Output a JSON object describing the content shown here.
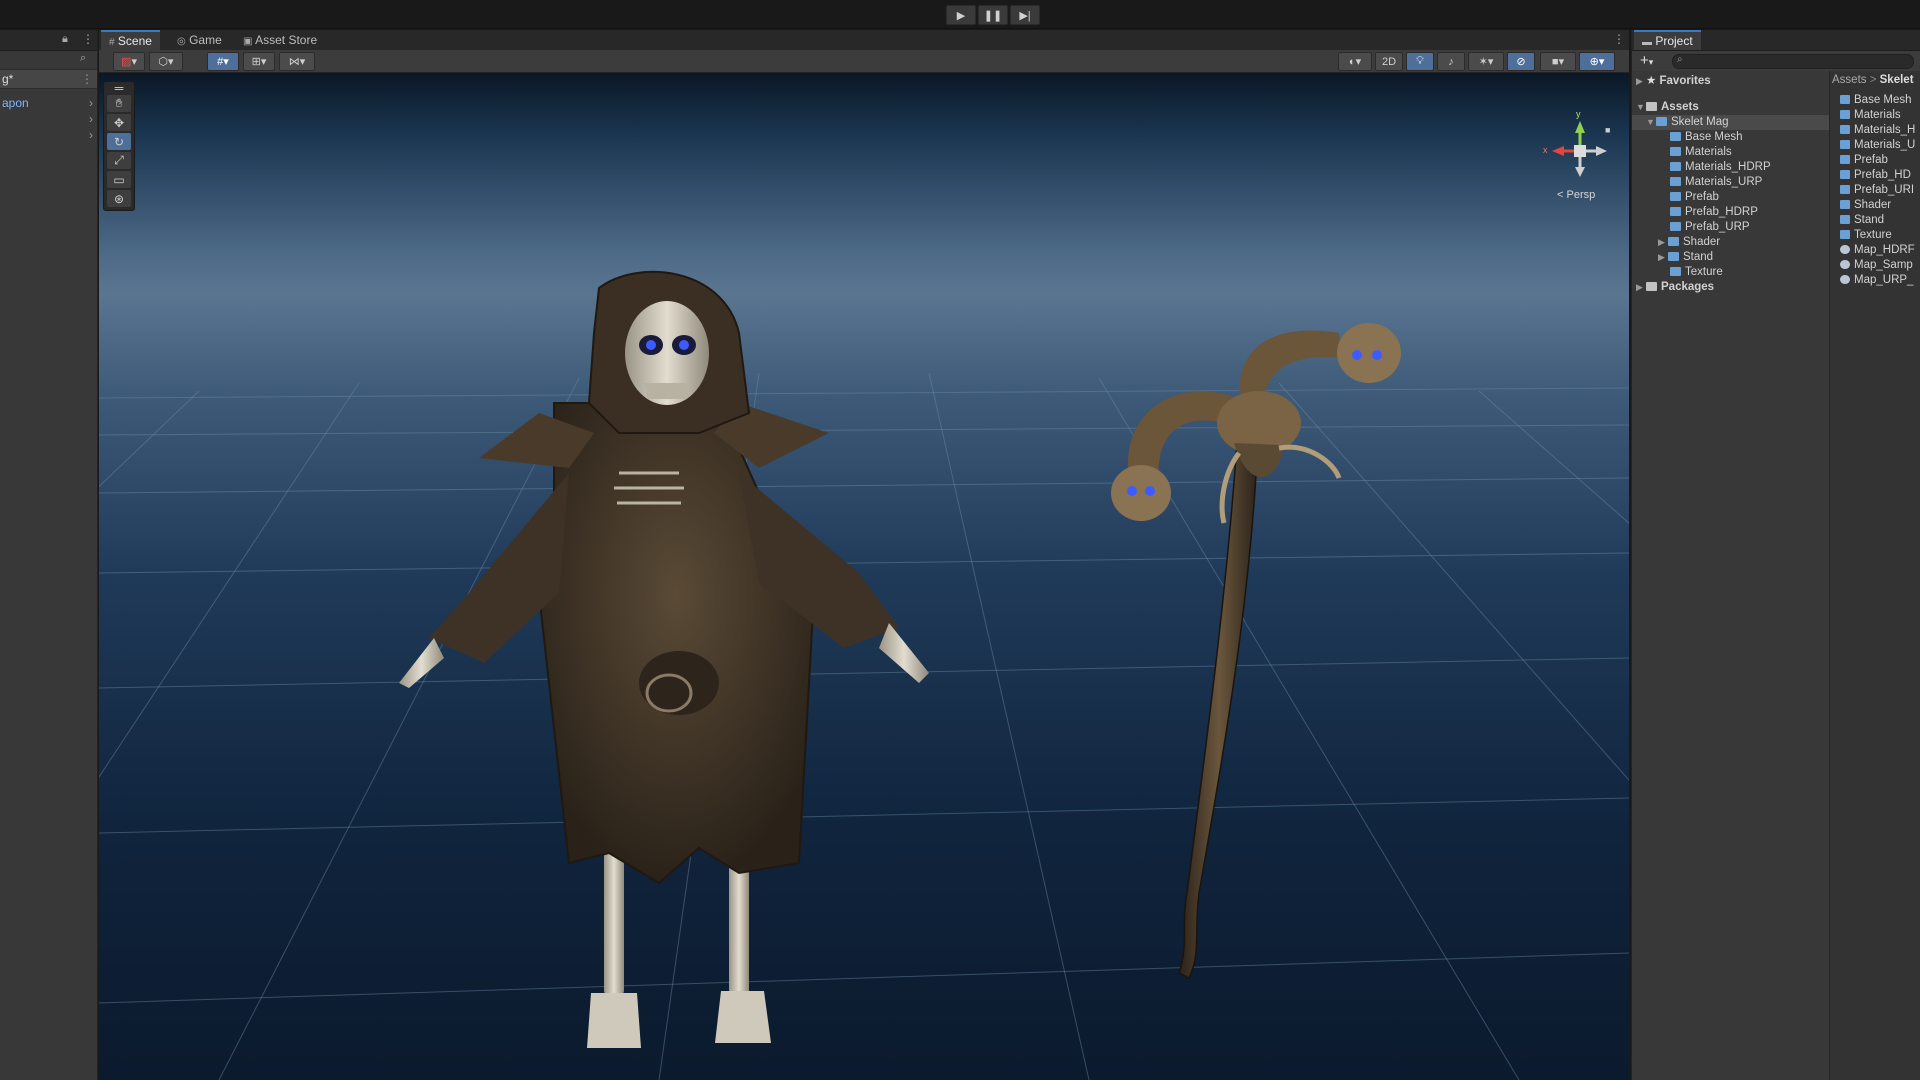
{
  "toolbar": {
    "play_icon": "play-icon",
    "pause_icon": "pause-icon",
    "step_icon": "step-icon"
  },
  "hierarchy": {
    "scene_name": "g*",
    "items": [
      {
        "label": "apon"
      },
      {
        "label": ""
      },
      {
        "label": ""
      }
    ]
  },
  "scene_tabs": [
    {
      "label": "Scene",
      "icon": "grid-icon"
    },
    {
      "label": "Game",
      "icon": "gamepad-icon"
    },
    {
      "label": "Asset Store",
      "icon": "store-icon"
    }
  ],
  "scene_toolbar": {
    "mode_2d": "2D"
  },
  "gizmo": {
    "axis_y": "y",
    "axis_x": "x",
    "projection": "Persp"
  },
  "project": {
    "tab_label": "Project",
    "add_label": "+",
    "favorites_label": "Favorites",
    "tree": [
      {
        "label": "Assets",
        "level": 0,
        "bold": true,
        "expanded": true
      },
      {
        "label": "Skelet Mag",
        "level": 1,
        "selected": true,
        "expanded": true
      },
      {
        "label": "Base Mesh",
        "level": 2
      },
      {
        "label": "Materials",
        "level": 2
      },
      {
        "label": "Materials_HDRP",
        "level": 2
      },
      {
        "label": "Materials_URP",
        "level": 2
      },
      {
        "label": "Prefab",
        "level": 2
      },
      {
        "label": "Prefab_HDRP",
        "level": 2
      },
      {
        "label": "Prefab_URP",
        "level": 2
      },
      {
        "label": "Shader",
        "level": 2,
        "collapsed": true
      },
      {
        "label": "Stand",
        "level": 2,
        "collapsed": true
      },
      {
        "label": "Texture",
        "level": 2
      }
    ],
    "packages_label": "Packages",
    "breadcrumb": {
      "root": "Assets",
      "separator": ">",
      "current": "Skelet"
    },
    "grid_items": [
      {
        "label": "Base Mesh",
        "kind": "folder"
      },
      {
        "label": "Materials",
        "kind": "folder"
      },
      {
        "label": "Materials_H",
        "kind": "folder"
      },
      {
        "label": "Materials_U",
        "kind": "folder"
      },
      {
        "label": "Prefab",
        "kind": "folder"
      },
      {
        "label": "Prefab_HD",
        "kind": "folder"
      },
      {
        "label": "Prefab_URI",
        "kind": "folder"
      },
      {
        "label": "Shader",
        "kind": "folder"
      },
      {
        "label": "Stand",
        "kind": "folder"
      },
      {
        "label": "Texture",
        "kind": "folder"
      },
      {
        "label": "Map_HDRF",
        "kind": "scene"
      },
      {
        "label": "Map_Samp",
        "kind": "scene"
      },
      {
        "label": "Map_URP_",
        "kind": "scene"
      }
    ]
  }
}
